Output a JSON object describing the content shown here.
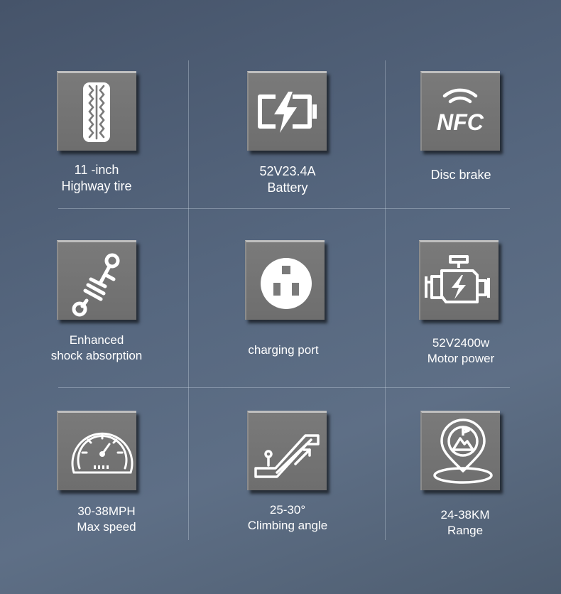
{
  "features": [
    {
      "icon": "tire-icon",
      "line1": "11 -inch",
      "line2": "Highway tire"
    },
    {
      "icon": "battery-icon",
      "line1": "52V23.4A",
      "line2": "Battery"
    },
    {
      "icon": "nfc-icon",
      "icon_text": "NFC",
      "line1": "Disc brake",
      "line2": ""
    },
    {
      "icon": "shock-absorber-icon",
      "line1": "Enhanced",
      "line2": "shock absorption"
    },
    {
      "icon": "charging-port-icon",
      "line1": "charging port",
      "line2": ""
    },
    {
      "icon": "motor-icon",
      "line1": "52V2400w",
      "line2": "Motor power"
    },
    {
      "icon": "speedometer-icon",
      "line1": "30-38MPH",
      "line2": "Max speed"
    },
    {
      "icon": "climbing-icon",
      "line1": "25-30°",
      "line2": "Climbing angle"
    },
    {
      "icon": "range-pin-icon",
      "line1": "24-38KM",
      "line2": "Range"
    }
  ]
}
